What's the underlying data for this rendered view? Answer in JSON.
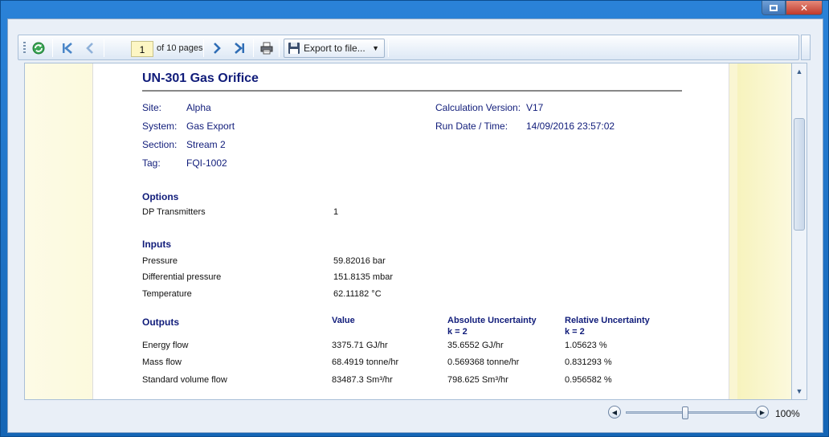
{
  "window": {
    "accent": "#1e6fc0"
  },
  "toolbar": {
    "page_current": "1",
    "page_of": "of 10 pages",
    "export_label": "Export to file..."
  },
  "report": {
    "title": "UN-301  Gas Orifice",
    "header_left": [
      {
        "label": "Site:",
        "value": "Alpha"
      },
      {
        "label": "System:",
        "value": "Gas Export"
      },
      {
        "label": "Section:",
        "value": "Stream 2"
      },
      {
        "label": "Tag:",
        "value": "FQI-1002"
      }
    ],
    "header_right": [
      {
        "label": "Calculation Version:",
        "value": "V17"
      },
      {
        "label": "Run Date / Time:",
        "value": "14/09/2016 23:57:02"
      }
    ],
    "options": {
      "heading": "Options",
      "rows": [
        {
          "label": "DP Transmitters",
          "value": "1"
        }
      ]
    },
    "inputs": {
      "heading": "Inputs",
      "rows": [
        {
          "label": "Pressure",
          "value": "59.82016 bar"
        },
        {
          "label": "Differential pressure",
          "value": "151.8135 mbar"
        },
        {
          "label": "Temperature",
          "value": "62.11182 °C"
        }
      ]
    },
    "outputs": {
      "heading": "Outputs",
      "col_value": "Value",
      "col_abs": "Absolute Uncertainty",
      "col_abs_k": "k = 2",
      "col_rel": "Relative Uncertainty",
      "col_rel_k": "k = 2",
      "rows": [
        {
          "label": "Energy flow",
          "value": "3375.71 GJ/hr",
          "abs": "35.6552 GJ/hr",
          "rel": "1.05623 %"
        },
        {
          "label": "Mass flow",
          "value": "68.4919 tonne/hr",
          "abs": "0.569368 tonne/hr",
          "rel": "0.831293 %"
        },
        {
          "label": "Standard volume flow",
          "value": "83487.3 Sm³/hr",
          "abs": "798.625 Sm³/hr",
          "rel": "0.956582 %"
        }
      ]
    }
  },
  "zoom": {
    "label": "100%",
    "level_percent": 100
  }
}
